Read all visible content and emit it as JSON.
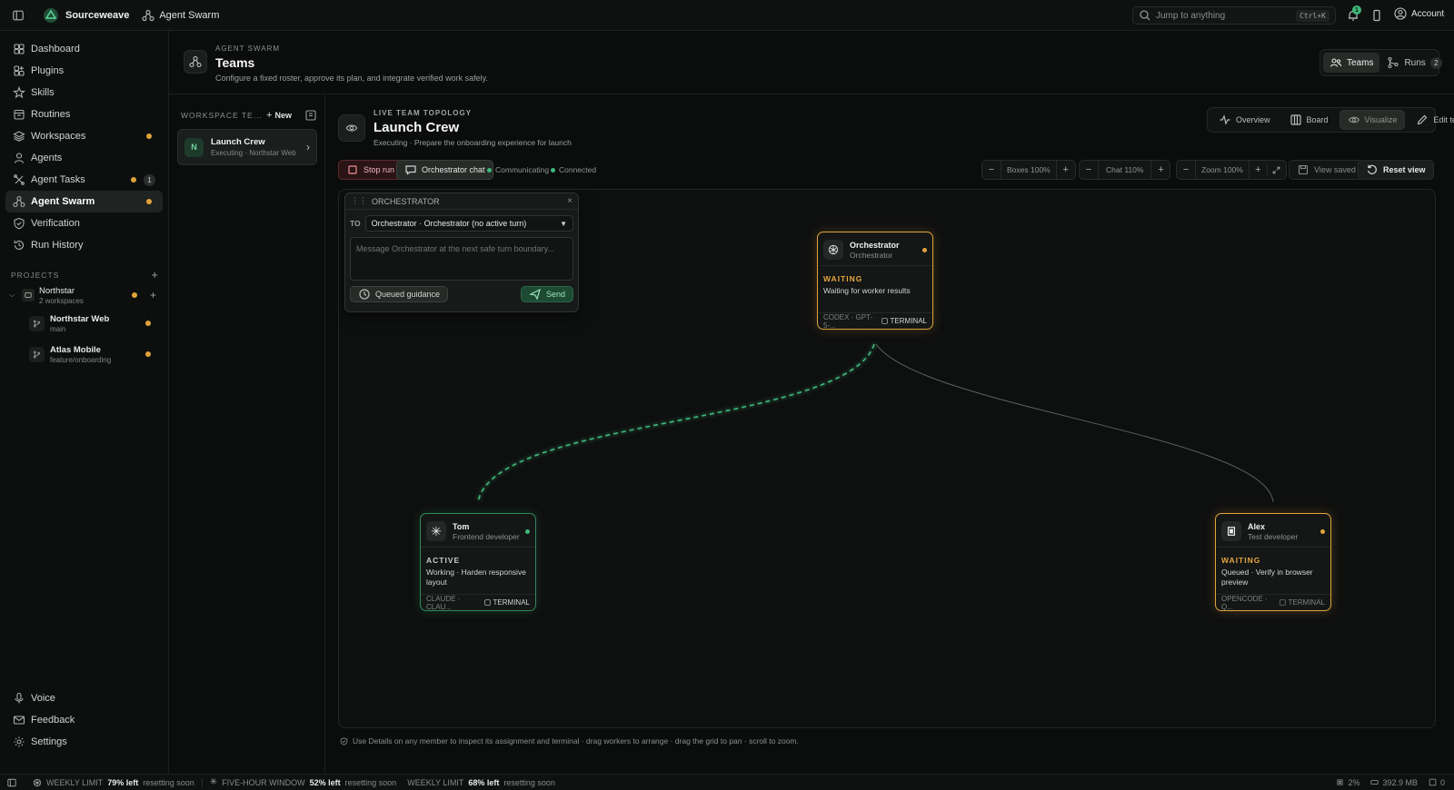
{
  "topbar": {
    "app_name": "Sourceweave",
    "breadcrumb": "Agent Swarm",
    "search_placeholder": "Jump to anything",
    "search_shortcut": "Ctrl+K",
    "notification_count": "1",
    "account_label": "Account"
  },
  "sidebar": {
    "items": [
      {
        "label": "Dashboard",
        "icon": "dashboard-icon"
      },
      {
        "label": "Plugins",
        "icon": "plugins-icon"
      },
      {
        "label": "Skills",
        "icon": "skills-icon"
      },
      {
        "label": "Routines",
        "icon": "routines-icon"
      },
      {
        "label": "Workspaces",
        "icon": "layers-icon"
      },
      {
        "label": "Agents",
        "icon": "user-icon"
      },
      {
        "label": "Agent Tasks",
        "icon": "tasks-icon",
        "badge": "1"
      },
      {
        "label": "Agent Swarm",
        "icon": "swarm-icon"
      },
      {
        "label": "Verification",
        "icon": "shield-icon"
      },
      {
        "label": "Run History",
        "icon": "history-icon"
      }
    ],
    "projects_label": "PROJECTS",
    "project": {
      "name": "Northstar",
      "sub": "2 workspaces"
    },
    "workspaces": [
      {
        "name": "Northstar Web",
        "branch": "main"
      },
      {
        "name": "Atlas Mobile",
        "branch": "feature/onboarding"
      }
    ],
    "bottom": [
      {
        "label": "Voice",
        "icon": "mic-icon"
      },
      {
        "label": "Feedback",
        "icon": "mail-icon"
      },
      {
        "label": "Settings",
        "icon": "gear-icon"
      }
    ]
  },
  "header": {
    "eyebrow": "AGENT SWARM",
    "title": "Teams",
    "subtitle": "Configure a fixed roster, approve its plan, and integrate verified work safely.",
    "tab_teams": "Teams",
    "tab_runs": "Runs",
    "runs_count": "2"
  },
  "teams_panel": {
    "label": "WORKSPACE TE...",
    "new_label": "New",
    "team": {
      "initial": "N",
      "name": "Launch Crew",
      "sub": "Executing · Northstar Web"
    }
  },
  "topology": {
    "eyebrow": "LIVE TEAM TOPOLOGY",
    "title": "Launch Crew",
    "subtitle": "Executing · Prepare the onboarding experience for launch",
    "views": {
      "overview": "Overview",
      "board": "Board",
      "visualize": "Visualize",
      "edit": "Edit team"
    },
    "stop_run": "Stop run",
    "orchestrator_chat": "Orchestrator chat",
    "communicating": "Communicating",
    "connected": "Connected",
    "boxes": "Boxes 100%",
    "chat": "Chat 110%",
    "zoom": "Zoom 100%",
    "view_saved": "View saved",
    "reset_view": "Reset view",
    "hint": "Use Details on any member to inspect its assignment and terminal · drag workers to arrange · drag the grid to pan · scroll to zoom."
  },
  "chat_panel": {
    "title": "ORCHESTRATOR",
    "to_label": "TO",
    "to_value": "Orchestrator · Orchestrator (no active turn)",
    "placeholder": "Message Orchestrator at the next safe turn boundary...",
    "queued": "Queued guidance",
    "send": "Send"
  },
  "nodes": [
    {
      "name": "Orchestrator",
      "role": "Orchestrator",
      "status": "WAITING",
      "desc": "Waiting for worker results",
      "engine": "CODEX · GPT-5-...",
      "terminal": "TERMINAL",
      "icon": "openai-icon",
      "color": "#e0a33b"
    },
    {
      "name": "Tom",
      "role": "Frontend developer",
      "status": "ACTIVE",
      "desc": "Working · Harden responsive layout",
      "engine": "CLAUDE · CLAU...",
      "terminal": "TERMINAL",
      "icon": "claude-icon",
      "color": "#3fb87a"
    },
    {
      "name": "Alex",
      "role": "Test developer",
      "status": "WAITING",
      "desc": "Queued · Verify in browser preview",
      "engine": "OPENCODE · Q...",
      "terminal": "TERMINAL",
      "icon": "opencode-icon",
      "color": "#e0a33b"
    }
  ],
  "statusbar": {
    "weekly_label": "WEEKLY LIMIT",
    "weekly_value": "79% left",
    "weekly_reset": "resetting soon",
    "five_label": "FIVE-HOUR WINDOW",
    "five_value": "52% left",
    "five_reset": "resetting soon",
    "weekly2_label": "WEEKLY LIMIT",
    "weekly2_value": "68% left",
    "weekly2_reset": "resetting soon",
    "cpu": "2%",
    "mem": "392.9 MB",
    "count": "0"
  }
}
